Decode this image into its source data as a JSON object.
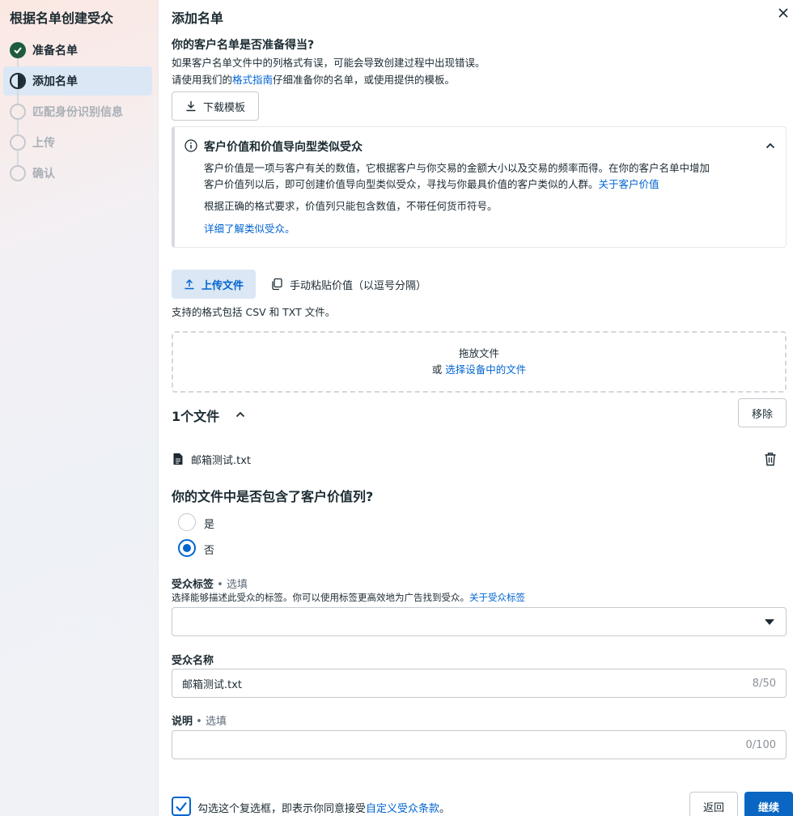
{
  "sidebar": {
    "title": "根据名单创建受众",
    "steps": [
      {
        "label": "准备名单",
        "status": "done"
      },
      {
        "label": "添加名单",
        "status": "current"
      },
      {
        "label": "匹配身份识别信息",
        "status": "pending"
      },
      {
        "label": "上传",
        "status": "pending"
      },
      {
        "label": "确认",
        "status": "pending"
      }
    ]
  },
  "main": {
    "title": "添加名单",
    "question1": "你的客户名单是否准备得当?",
    "desc1": "如果客户名单文件中的列格式有误，可能会导致创建过程中出现错误。",
    "desc2_pre": "请使用我们的",
    "desc2_link": "格式指南",
    "desc2_post": "仔细准备你的名单，或使用提供的模板。",
    "download_button": "下载模板",
    "info": {
      "title": "客户价值和价值导向型类似受众",
      "p1_line1": "客户价值是一项与客户有关的数值，它根据客户与你交易的金额大小以及交易的频率而得。在你的客户名单中增加",
      "p1_line2": "客户价值列以后，即可创建价值导向型类似受众，寻找与你最具价值的客户类似的人群。",
      "p1_link": "关于客户价值",
      "p2": "根据正确的格式要求，价值列只能包含数值，不带任何货币符号。",
      "p3_link": "详细了解类似受众。"
    },
    "tabs": {
      "upload": "上传文件",
      "paste": "手动粘贴价值（以逗号分隔）"
    },
    "supported_formats": "支持的格式包括 CSV 和 TXT 文件。",
    "dropzone": {
      "title": "拖放文件",
      "or": "或",
      "link": "选择设备中的文件"
    },
    "file_count": "1个文件",
    "remove_button": "移除",
    "file_name": "邮箱测试.txt",
    "question2": "你的文件中是否包含了客户价值列?",
    "radio_yes": "是",
    "radio_no": "否",
    "selected_radio": "否",
    "tags": {
      "label": "受众标签",
      "optional": " • 选填",
      "help": "选择能够描述此受众的标签。你可以使用标签更高效地为广告找到受众。",
      "help_link": "关于受众标签",
      "value": ""
    },
    "audience_name": {
      "label": "受众名称",
      "value": "邮箱测试.txt",
      "counter": "8/50"
    },
    "description": {
      "label": "说明",
      "optional": " • 选填",
      "value": "",
      "counter": "0/100"
    },
    "terms_pre": "勾选这个复选框，即表示你同意接受",
    "terms_link": "自定义受众条款",
    "terms_post": "。",
    "back_button": "返回",
    "continue_button": "继续"
  },
  "colors": {
    "accent": "#0064d1",
    "primary_button": "#0a66c2",
    "done_step": "#1e5b3c",
    "active_step_bg": "#dbe7f5"
  }
}
